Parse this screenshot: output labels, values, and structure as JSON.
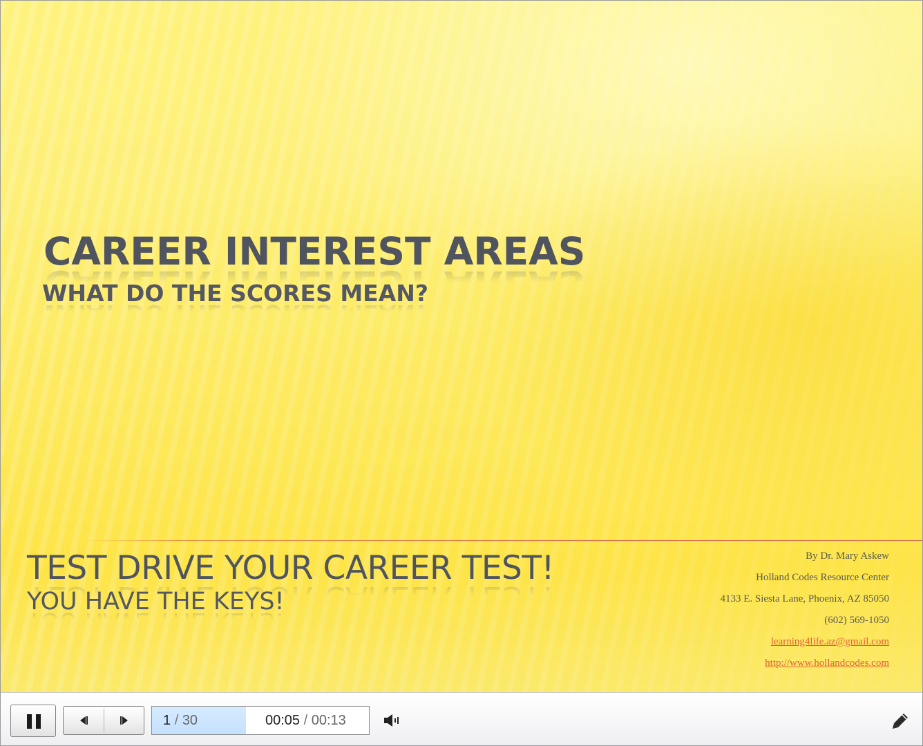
{
  "slide": {
    "title": "CAREER INTEREST AREAS",
    "subtitle": "WHAT DO THE SCORES MEAN?",
    "tagline": "TEST DRIVE YOUR CAREER TEST!",
    "tagline_sub": "YOU HAVE THE KEYS!",
    "contact": {
      "author": "By  Dr. Mary Askew",
      "organization": "Holland Codes Resource Center",
      "address": "4133 E. Siesta Lane, Phoenix, AZ 85050",
      "phone": "(602) 569-1050",
      "email": "learning4life.az@gmail.com",
      "website": "http://www.hollandcodes.com"
    }
  },
  "player": {
    "current_slide": "1",
    "slide_separator": "/",
    "total_slides": "30",
    "elapsed_time": "00:05",
    "time_separator": "/",
    "total_time": "00:13"
  },
  "icons": {
    "pause": "pause-icon",
    "prev": "previous-slide-icon",
    "next": "next-slide-icon",
    "volume": "volume-icon",
    "annotate": "pencil-icon"
  },
  "colors": {
    "title_text": "#50545f",
    "link": "#e0603a",
    "divider": "#e0704a",
    "slide_counter_bg": "#c5e1fd"
  }
}
